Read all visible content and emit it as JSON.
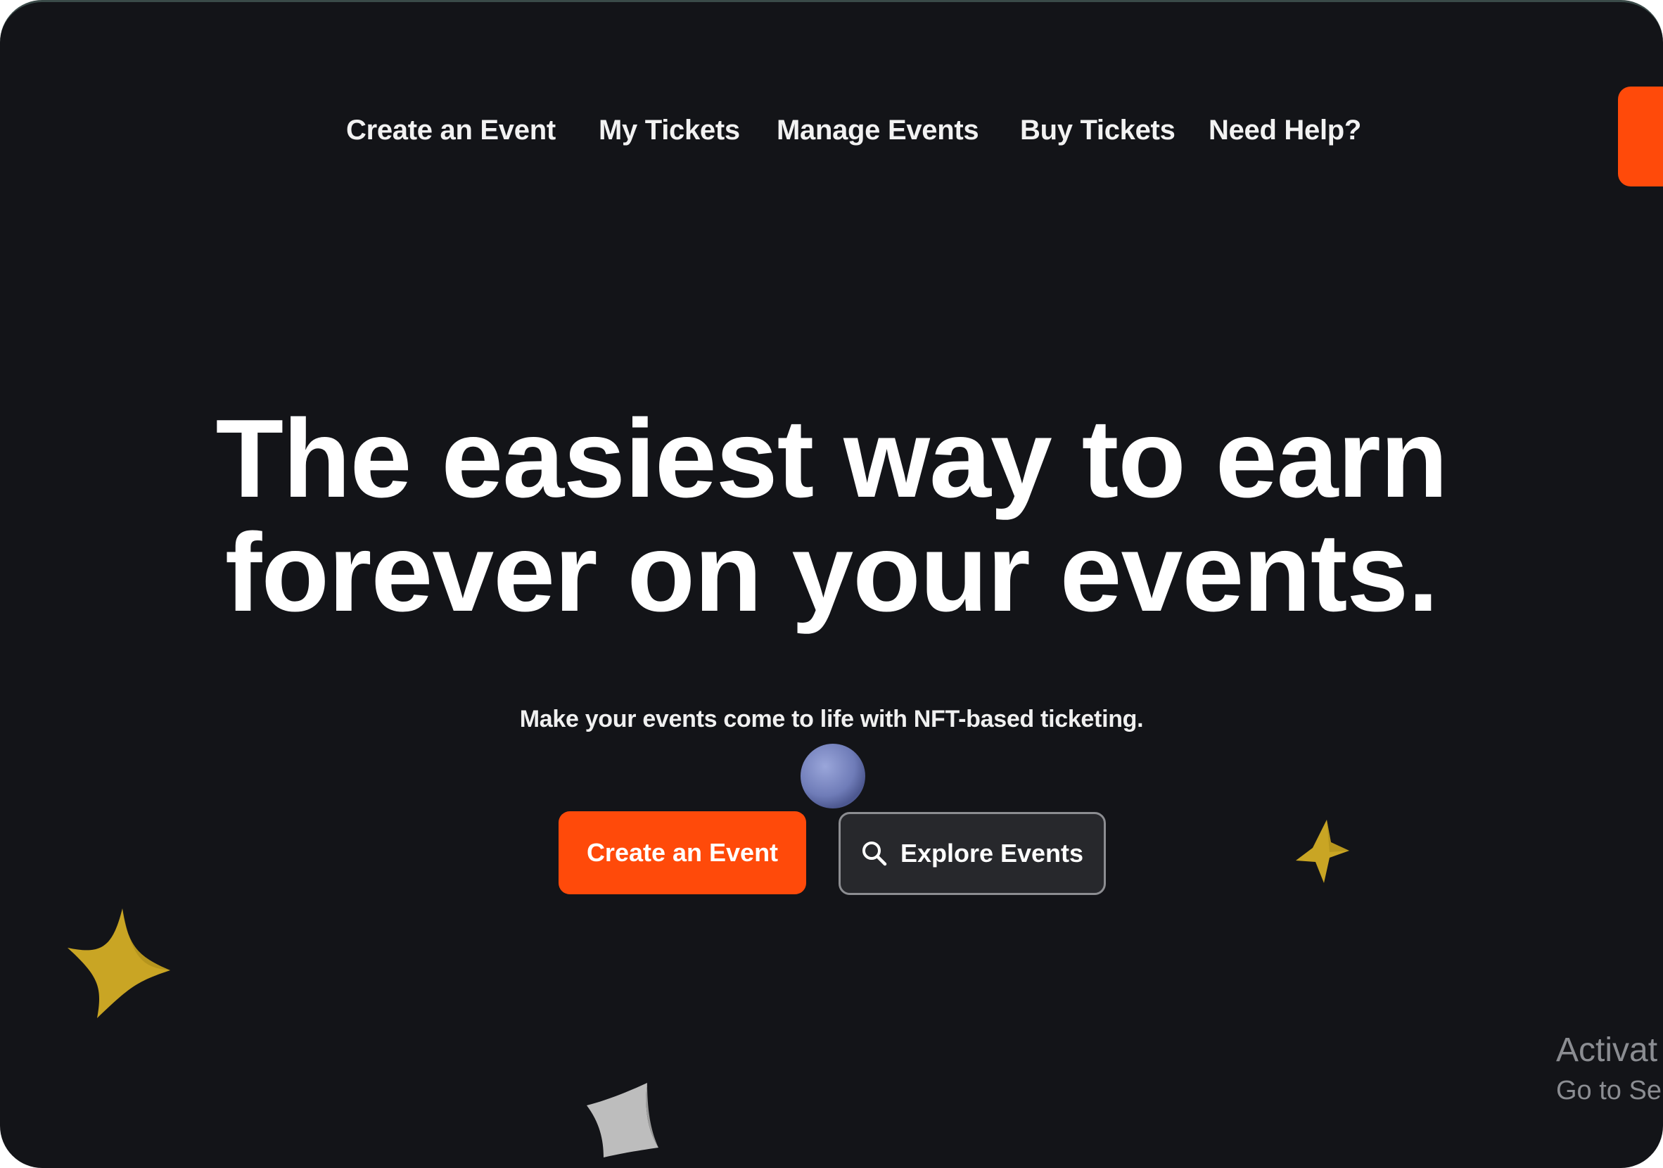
{
  "nav": {
    "items": [
      {
        "label": "Create an Event"
      },
      {
        "label": "My Tickets"
      },
      {
        "label": "Manage Events"
      },
      {
        "label": "Buy Tickets"
      },
      {
        "label": "Need Help?"
      }
    ]
  },
  "hero": {
    "headline_line1": "The easiest way to earn",
    "headline_line2": "forever on your events.",
    "subtitle": "Make your events come to life with NFT-based ticketing.",
    "primary_button": "Create an Event",
    "secondary_button": "Explore Events",
    "secondary_button_icon": "search-icon"
  },
  "watermark": {
    "line1": "Activat",
    "line2": "Go to Se"
  },
  "colors": {
    "background": "#131418",
    "accent": "#ff4a0a",
    "star_gold": "#c9a524",
    "sphere": "#7b88c4",
    "confetti_gray": "#bdbdbd"
  }
}
